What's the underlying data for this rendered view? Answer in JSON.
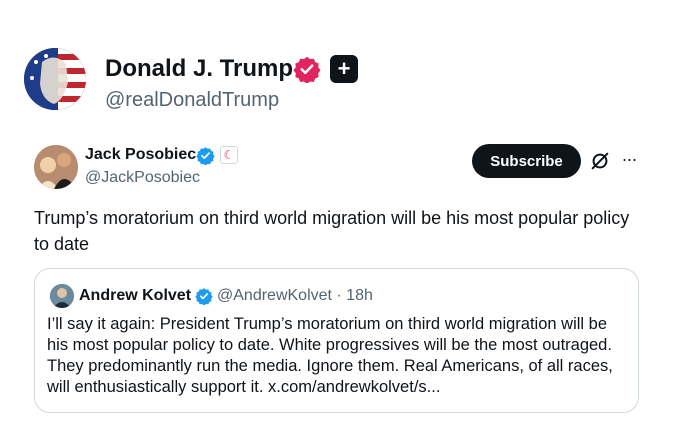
{
  "profile": {
    "name": "Donald J. Trump",
    "handle": "@realDonaldTrump",
    "affiliate_glyph": "+"
  },
  "tweet": {
    "author_name": "Jack Posobiec",
    "author_handle": "@JackPosobiec",
    "affiliate_glyph": "☾",
    "subscribe_label": "Subscribe",
    "more_label": "···",
    "text": "Trump’s moratorium on third world migration will be his most popular policy to date"
  },
  "quote": {
    "author_name": "Andrew Kolvet",
    "meta": "@AndrewKolvet · 18h",
    "text": "I’ll say it again: President Trump’s moratorium on third world migration will be his most popular policy to date. White progressives will be the most outraged. They predominantly run the media. Ignore them. Real Americans, of all races, will enthusiastically support it. x.com/andrewkolvet/s..."
  },
  "colors": {
    "verified_pink": "#e0245e",
    "verified_blue": "#1d9bf0",
    "text_primary": "#0f1419",
    "text_secondary": "#536471",
    "border": "#cfd9de"
  },
  "icons": {
    "profile_verified": "verified-badge-pink-icon",
    "affiliate": "affiliate-plus-icon",
    "tweet_verified": "verified-badge-blue-icon",
    "grok": "grok-icon",
    "more": "more-icon"
  }
}
